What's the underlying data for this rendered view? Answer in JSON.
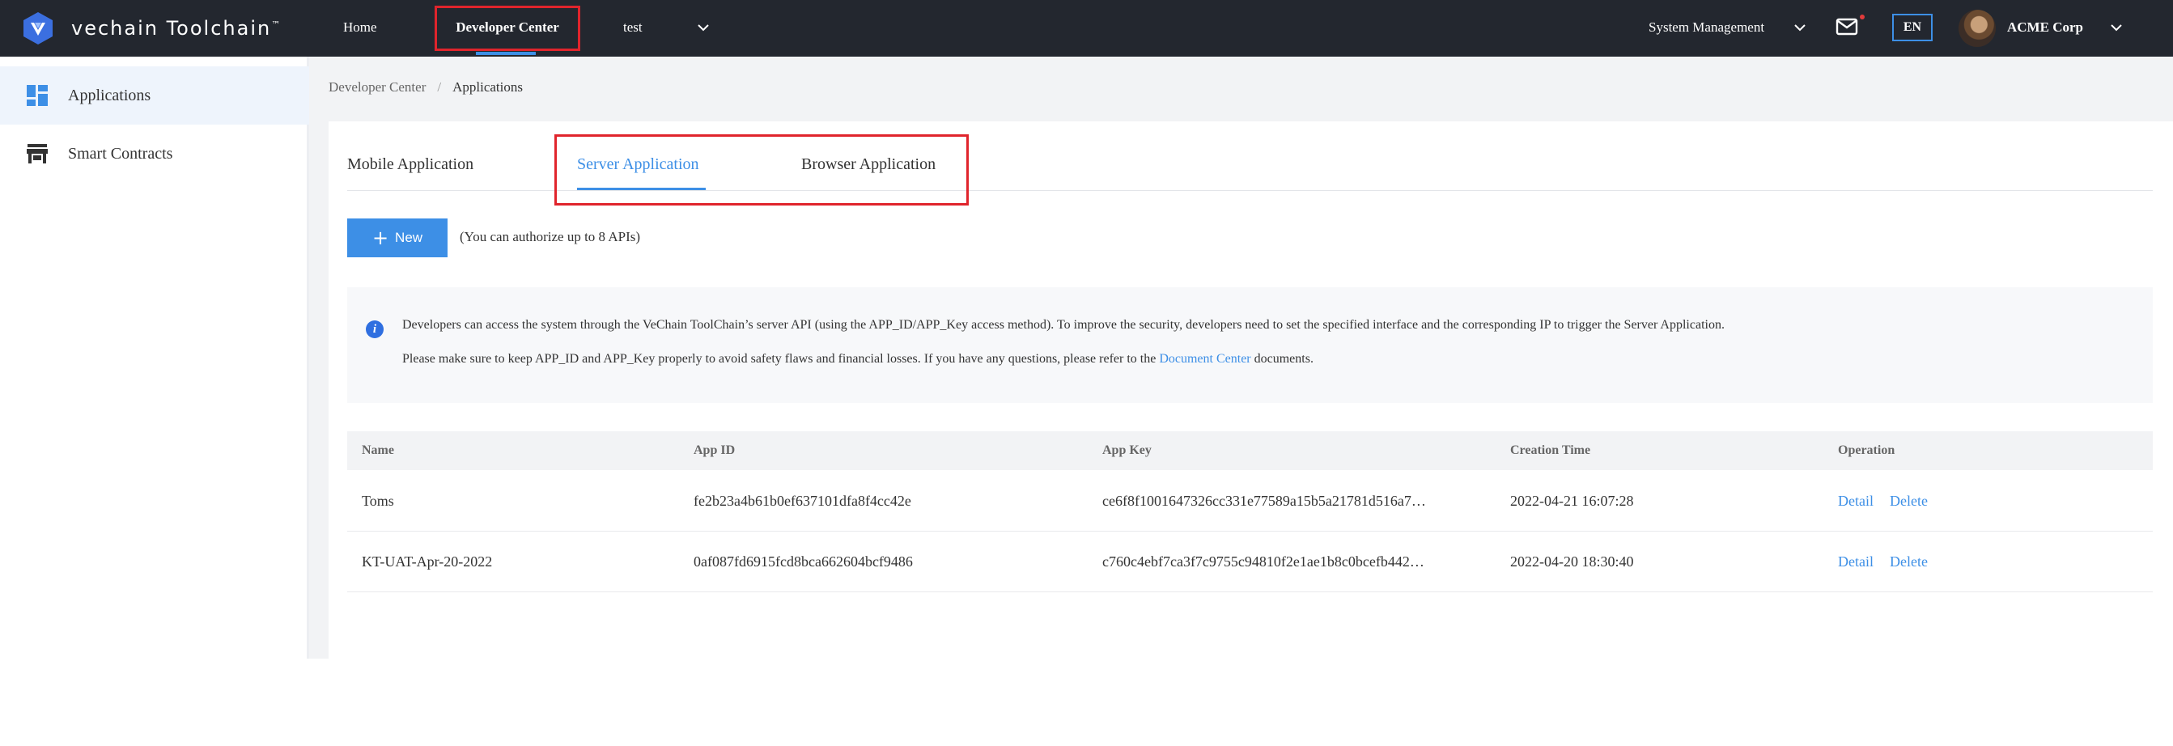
{
  "topbar": {
    "logo_text": "vechain Toolchain",
    "logo_tm": "™",
    "nav": {
      "home": "Home",
      "developer_center": "Developer Center",
      "project": "test"
    },
    "system_management": "System Management",
    "language": "EN",
    "user_name": "ACME Corp"
  },
  "sidebar": {
    "items": [
      {
        "label": "Applications",
        "icon": "dashboard-icon",
        "active": true
      },
      {
        "label": "Smart Contracts",
        "icon": "store-icon",
        "active": false
      }
    ]
  },
  "breadcrumb": {
    "parent": "Developer Center",
    "separator": "/",
    "current": "Applications"
  },
  "tabs": {
    "mobile": "Mobile Application",
    "server": "Server Application",
    "browser": "Browser Application",
    "active": "Server Application"
  },
  "actions": {
    "new_label": "New",
    "new_hint": "(You can authorize up to 8 APIs)"
  },
  "info": {
    "line1": "Developers can access the system through the VeChain ToolChain’s server API (using the APP_ID/APP_Key access method). To improve the security, developers need to set the specified interface and the corresponding IP to trigger the Server Application.",
    "line2_before": "Please make sure to keep APP_ID and APP_Key properly to avoid safety flaws and financial losses. If you have any questions, please refer to the ",
    "line2_link": "Document Center",
    "line2_after": " documents."
  },
  "table": {
    "columns": {
      "name": "Name",
      "app_id": "App ID",
      "app_key": "App Key",
      "creation_time": "Creation Time",
      "operation": "Operation"
    },
    "rows": [
      {
        "name": "Toms",
        "app_id": "fe2b23a4b61b0ef637101dfa8f4cc42e",
        "app_key": "ce6f8f1001647326cc331e77589a15b5a21781d516a7…",
        "creation_time": "2022-04-21 16:07:28",
        "detail": "Detail",
        "delete": "Delete"
      },
      {
        "name": "KT-UAT-Apr-20-2022",
        "app_id": "0af087fd6915fcd8bca662604bcf9486",
        "app_key": "c760c4ebf7ca3f7c9755c94810f2e1ae1b8c0bcefb442…",
        "creation_time": "2022-04-20 18:30:40",
        "detail": "Detail",
        "delete": "Delete"
      }
    ]
  },
  "colors": {
    "accent": "#3d8fe6",
    "topbar": "#23272f",
    "highlight": "#e0242c"
  }
}
